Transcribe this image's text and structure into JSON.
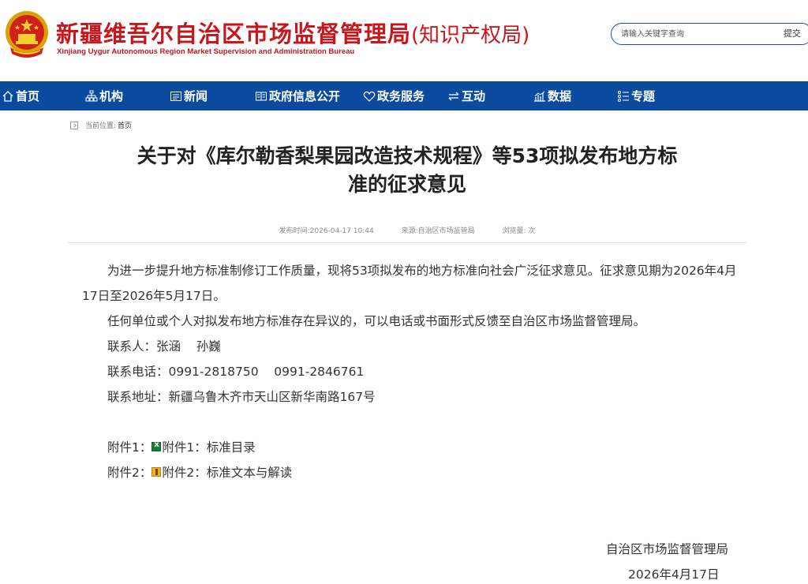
{
  "header": {
    "title_main": "新疆维吾尔自治区市场监督管理局",
    "title_sub": "(知识产权局)",
    "title_en": "Xinjiang Uygur Autonomous Region Market Supervision and Administration Bureau",
    "search_placeholder": "请输入关键字查询",
    "search_button": "提交"
  },
  "nav": {
    "items": [
      {
        "label": "首页",
        "icon": "home-icon"
      },
      {
        "label": "机构",
        "icon": "org-chart-icon"
      },
      {
        "label": "新闻",
        "icon": "news-icon"
      },
      {
        "label": "政府信息公开",
        "icon": "info-open-icon"
      },
      {
        "label": "政务服务",
        "icon": "heart-icon"
      },
      {
        "label": "互动",
        "icon": "exchange-icon"
      },
      {
        "label": "数据",
        "icon": "chart-icon"
      },
      {
        "label": "专题",
        "icon": "list-icon"
      }
    ]
  },
  "breadcrumb": {
    "prefix": "当前位置:",
    "home": "首页"
  },
  "article": {
    "title_line1": "关于对《库尔勒香梨果园改造技术规程》等53项拟发布地方标",
    "title_line2": "准的征求意见",
    "publish_time": "发布时间:2026-04-17 10:44",
    "source": "来源:自治区市场监管局",
    "views": "浏览量: 次",
    "paragraph1": "为进一步提升地方标准制修订工作质量，现将53项拟发布的地方标准向社会广泛征求意见。征求意见期为2026年4月17日至2026年5月17日。",
    "paragraph2": "任何单位或个人对拟发布地方标准存在异议的，可以电话或书面形式反馈至自治区市场监督管理局。",
    "contact_person": "联系人：张涵    孙巍",
    "contact_phone": "联系电话：0991-2818750    0991-2846761",
    "contact_address": "联系地址：新疆乌鲁木齐市天山区新华南路167号",
    "attachment1_label": "附件1：",
    "attachment1_link": "附件1：标准目录",
    "attachment2_label": "附件2：",
    "attachment2_link": "附件2：标准文本与解读",
    "sign_org": "自治区市场监督管理局",
    "sign_date": "2026年4月17日"
  },
  "colors": {
    "brand_red": "#c8161d",
    "nav_blue": "#0a4a9f"
  }
}
